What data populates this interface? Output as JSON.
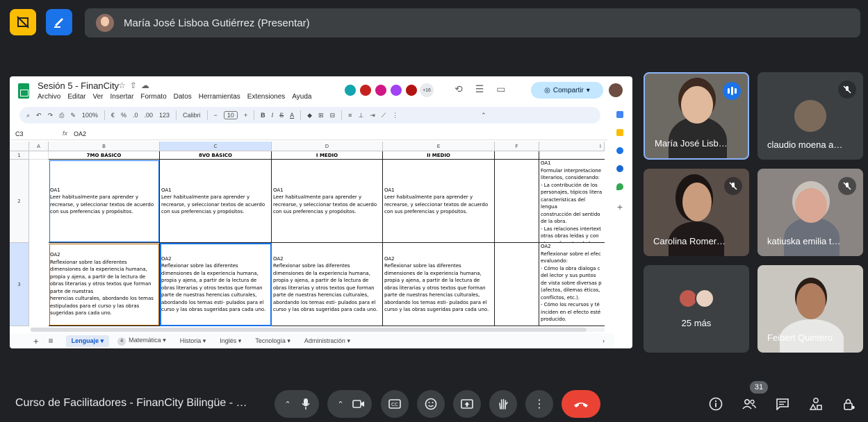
{
  "presenter_bar": {
    "name": "María José Lisboa Gutiérrez (Presentar)"
  },
  "sheet": {
    "title": "Sesión 5 - FinanCity",
    "menu": [
      "Archivo",
      "Editar",
      "Ver",
      "Insertar",
      "Formato",
      "Datos",
      "Herramientas",
      "Extensiones",
      "Ayuda"
    ],
    "collaborators_more": "+16",
    "share_label": "Compartir",
    "toolbar": {
      "zoom": "100%",
      "currency": "€",
      "percent": "%",
      "dec1": ".0",
      "dec2": ".00",
      "numfmt": "123",
      "font": "Calibri",
      "font_size": "10"
    },
    "cell_ref": "C3",
    "formula_value": "OA2",
    "columns": [
      "A",
      "B",
      "C",
      "D",
      "E",
      "F",
      "I"
    ],
    "rows": [
      "1",
      "2",
      "3"
    ],
    "headers": [
      "7MO BÁSICO",
      "8VO BÁSICO",
      "I MEDIO",
      "II MEDIO"
    ],
    "row2": {
      "b": "OA1\nLeer habitualmente para aprender y recrearse, y seleccionar textos de acuerdo con sus preferencias y propósitos.",
      "c": "OA1\nLeer habitualmente para aprender y recrearse, y seleccionar textos de acuerdo con sus preferencias y propósitos.",
      "d": "OA1\nLeer habitualmente para aprender y recrearse, y seleccionar textos de acuerdo con sus preferencias y propósitos.",
      "e": "OA1\nLeer habitualmente para aprender y recrearse, y seleccionar textos de acuerdo con sus preferencias y propósitos.",
      "g": "OA1\nFormular interpretacione\nliterarios, considerando:\n- La contribución de los\npersonajes, tópicos litera\ncaracterísticas del lengua\nconstrucción del sentido\nde la obra.\n- Las relaciones intertext\notras obras leídas y con\notros referentes de la cu"
    },
    "row3": {
      "b": "OA2\nReflexionar sobre las diferentes\ndimensiones de la experiencia humana,\npropia y ajena, a partir de la lectura de\nobras literarias y otros textos que forman\nparte de nuestras\nherencias culturales, abordando los temas\nestipulados para el curso y las obras\nsugeridas para cada uno.",
      "c": "OA2\nReflexionar sobre las diferentes\ndimensiones de la experiencia humana,\npropia y ajena, a partir de la lectura de\nobras literarias y otros textos que forman\nparte de nuestras herencias culturales,\nabordando los temas esti- pulados para el\ncurso y las obras sugeridas para cada uno.",
      "d": "OA2\nReflexionar sobre las diferentes\ndimensiones de la experiencia humana,\npropia y ajena, a partir de la lectura de\nobras literarias y otros textos que forman\nparte de nuestras herencias culturales,\nabordando los temas esti- pulados para el\ncurso y las obras sugeridas para cada uno.",
      "e": "OA2\nReflexionar sobre las diferentes\ndimensiones de la experiencia humana,\npropia y ajena, a partir de la lectura de\nobras literarias y otros textos que forman\nparte de nuestras herencias culturales,\nabordando los temas esti- pulados para el\ncurso y las obras sugeridas para cada uno.",
      "g": "OA2\nReflexionar sobre el efec\nevaluando:\n- Cómo la obra dialoga c\ndel lector y sus puntos\nde vista sobre diversas p\n(afectos, dilemas éticos,\nconflictos, etc.).\n- Cómo los recursos y té\ninciden en el efecto esté\nproducido."
    },
    "tabs": [
      "Lenguaje",
      "Matemática",
      "Historia",
      "Inglés",
      "Tecnología",
      "Administración"
    ],
    "tab_badge": "4"
  },
  "participants": [
    {
      "name": "María José Lisb…",
      "state": "speaking"
    },
    {
      "name": "claudio moena a…",
      "state": "muted"
    },
    {
      "name": "Carolina Romer…",
      "state": "muted"
    },
    {
      "name": "katiuska emilia t…",
      "state": "muted"
    },
    {
      "name": "25 más",
      "state": "group"
    },
    {
      "name": "Feibert Quintero",
      "state": "video"
    }
  ],
  "bottom": {
    "meeting_title": "Curso de Facilitadores - FinanCity Bilingüe - …",
    "people_count": "31"
  },
  "colors": {
    "end_call": "#ea4335",
    "accent": "#8ab4f8",
    "sheets_green": "#0f9d58"
  }
}
